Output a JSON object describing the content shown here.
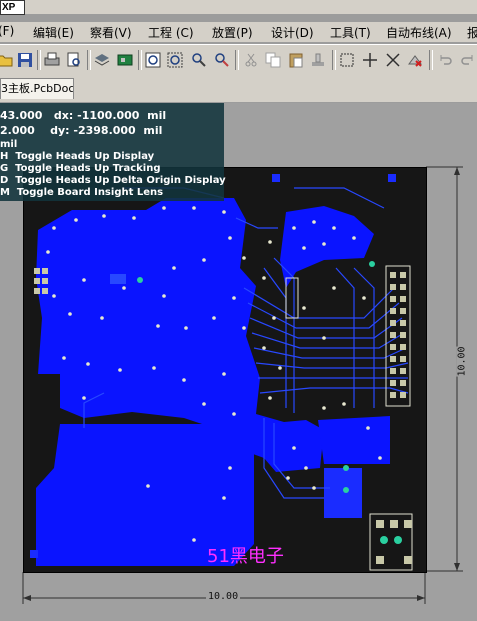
{
  "titlebar": {
    "label": "XP"
  },
  "menu": [
    {
      "id": "file",
      "label": "(F)"
    },
    {
      "id": "edit",
      "label": "编辑(E)"
    },
    {
      "id": "view",
      "label": "察看(V)"
    },
    {
      "id": "project",
      "label": "工程 (C)"
    },
    {
      "id": "place",
      "label": "放置(P)"
    },
    {
      "id": "design",
      "label": "设计(D)"
    },
    {
      "id": "tools",
      "label": "工具(T)"
    },
    {
      "id": "autoroute",
      "label": "自动布线(A)"
    },
    {
      "id": "report",
      "label": "报"
    }
  ],
  "toolbar_icons": [
    "open-folder-icon",
    "save-icon",
    "print-icon",
    "print-preview-icon",
    "layers-icon",
    "board-3d-icon",
    "zoom-fit-icon",
    "zoom-area-icon",
    "zoom-selected-icon",
    "zoom-filter-icon",
    "cut-icon",
    "copy-icon",
    "paste-icon",
    "rubber-stamp-icon",
    "select-area-icon",
    "move-icon",
    "deselect-icon",
    "clear-icon",
    "undo-icon",
    "redo-icon"
  ],
  "tab": {
    "label": "3主板.PcbDoc"
  },
  "hud": {
    "line1": "43.000   dx: -1100.000  mil",
    "line2": "2.000    dy: -2398.000  mil",
    "line3": "mil",
    "shortcuts": [
      "H  Toggle Heads Up Display",
      "G  Toggle Heads Up Tracking",
      "D  Toggle Heads Up Delta Origin Display",
      "M  Toggle Board Insight Lens"
    ]
  },
  "dimensions": {
    "width": "10.00",
    "height": "10.00"
  },
  "brand": "51黑电子",
  "colors": {
    "copper": "#0a14ff",
    "board": "#161616",
    "trace": "#2848ff",
    "via": "#e8e8d0",
    "pad": "#c8c8a8"
  }
}
